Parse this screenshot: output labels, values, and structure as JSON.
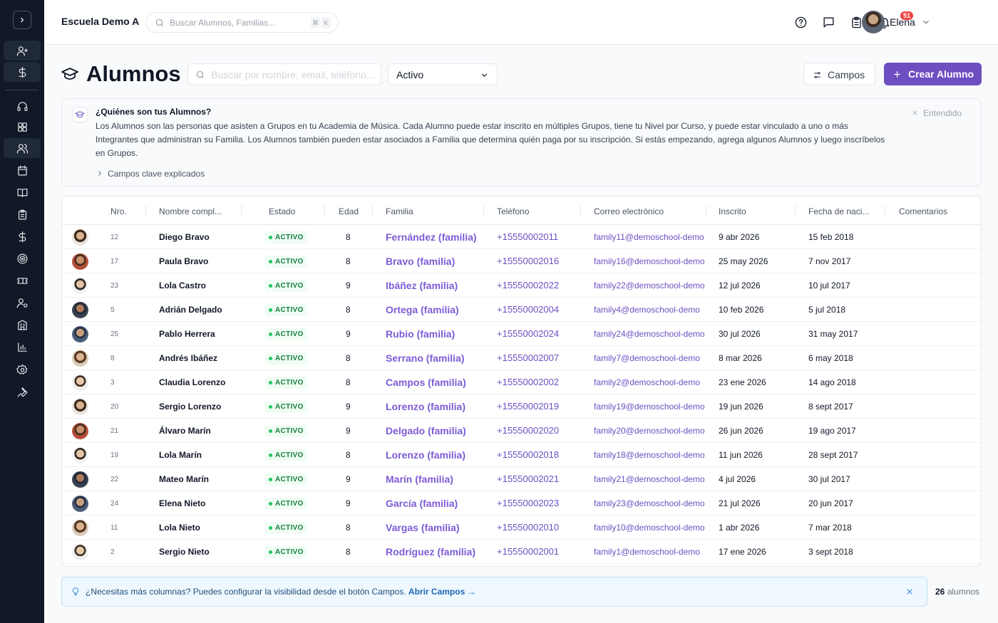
{
  "app": {
    "school_name": "Escuela Demo A",
    "user_name": "Elena",
    "notification_count": "51"
  },
  "global_search": {
    "placeholder": "Buscar Alumnos, Familias...",
    "kbd1": "⌘",
    "kbd2": "K"
  },
  "sidebar": {
    "icons": [
      "chevron-right-icon",
      "user-plus-icon",
      "dollar-icon",
      "headset-icon",
      "grid-icon",
      "users-icon",
      "calendar-icon",
      "book-icon",
      "clipboard-icon",
      "dollar-icon",
      "target-icon",
      "ticket-icon",
      "user-cog-icon",
      "building-icon",
      "bar-chart-icon",
      "settings-icon",
      "wrench-icon"
    ]
  },
  "page": {
    "title": "Alumnos",
    "search_placeholder": "Buscar por nombre, email, teléfono...",
    "status_filter": "Activo",
    "campos_button": "Campos",
    "create_button": "Crear Alumno"
  },
  "info": {
    "title": "¿Quiénes son tus Alumnos?",
    "body": "Los Alumnos son las personas que asisten a Grupos en tu Academia de Música. Cada Alumno puede estar inscrito en múltiples Grupos, tiene tu Nivel por Curso, y puede estar vinculado a uno o más Integrantes que administran su Familia. Los Alumnos también pueden estar asociados a Familia que determina quién paga por su inscripción. Si estás empezando, agrega algunos Alumnos y luego inscríbelos en Grupos.",
    "more_link": "Campos clave explicados",
    "dismiss": "Entendido"
  },
  "table": {
    "columns": [
      "Nro.",
      "Nombre compl...",
      "Estado",
      "Edad",
      "Familia",
      "Teléfono",
      "Correo electrónico",
      "Inscrito",
      "Fecha de naci...",
      "Comentarios"
    ],
    "rows": [
      {
        "nro": "12",
        "name": "Diego Bravo",
        "status": "ACTIVO",
        "age": "8",
        "family": "Fernández (familia)",
        "phone": "+15550002011",
        "email": "family11@demoschool-demo",
        "enrolled": "9 abr 2026",
        "birth": "15 feb 2018"
      },
      {
        "nro": "17",
        "name": "Paula Bravo",
        "status": "ACTIVO",
        "age": "8",
        "family": "Bravo (familia)",
        "phone": "+15550002016",
        "email": "family16@demoschool-demo",
        "enrolled": "25 may 2026",
        "birth": "7 nov 2017"
      },
      {
        "nro": "23",
        "name": "Lola Castro",
        "status": "ACTIVO",
        "age": "9",
        "family": "Ibáñez (familia)",
        "phone": "+15550002022",
        "email": "family22@demoschool-demo",
        "enrolled": "12 jul 2026",
        "birth": "10 jul 2017"
      },
      {
        "nro": "5",
        "name": "Adrián Delgado",
        "status": "ACTIVO",
        "age": "8",
        "family": "Ortega (familia)",
        "phone": "+15550002004",
        "email": "family4@demoschool-demo",
        "enrolled": "10 feb 2026",
        "birth": "5 jul 2018"
      },
      {
        "nro": "25",
        "name": "Pablo Herrera",
        "status": "ACTIVO",
        "age": "9",
        "family": "Rubio (familia)",
        "phone": "+15550002024",
        "email": "family24@demoschool-demo",
        "enrolled": "30 jul 2026",
        "birth": "31 may 2017"
      },
      {
        "nro": "8",
        "name": "Andrés Ibáñez",
        "status": "ACTIVO",
        "age": "8",
        "family": "Serrano (familia)",
        "phone": "+15550002007",
        "email": "family7@demoschool-demo",
        "enrolled": "8 mar 2026",
        "birth": "6 may 2018"
      },
      {
        "nro": "3",
        "name": "Claudia Lorenzo",
        "status": "ACTIVO",
        "age": "8",
        "family": "Campos (familia)",
        "phone": "+15550002002",
        "email": "family2@demoschool-demo",
        "enrolled": "23 ene 2026",
        "birth": "14 ago 2018"
      },
      {
        "nro": "20",
        "name": "Sergio Lorenzo",
        "status": "ACTIVO",
        "age": "9",
        "family": "Lorenzo (familia)",
        "phone": "+15550002019",
        "email": "family19@demoschool-demo",
        "enrolled": "19 jun 2026",
        "birth": "8 sept 2017"
      },
      {
        "nro": "21",
        "name": "Álvaro Marín",
        "status": "ACTIVO",
        "age": "9",
        "family": "Delgado (familia)",
        "phone": "+15550002020",
        "email": "family20@demoschool-demo",
        "enrolled": "26 jun 2026",
        "birth": "19 ago 2017"
      },
      {
        "nro": "19",
        "name": "Lola Marín",
        "status": "ACTIVO",
        "age": "8",
        "family": "Lorenzo (familia)",
        "phone": "+15550002018",
        "email": "family18@demoschool-demo",
        "enrolled": "11 jun 2026",
        "birth": "28 sept 2017"
      },
      {
        "nro": "22",
        "name": "Mateo Marín",
        "status": "ACTIVO",
        "age": "9",
        "family": "Marín (familia)",
        "phone": "+15550002021",
        "email": "family21@demoschool-demo",
        "enrolled": "4 jul 2026",
        "birth": "30 jul 2017"
      },
      {
        "nro": "24",
        "name": "Elena Nieto",
        "status": "ACTIVO",
        "age": "9",
        "family": "García (familia)",
        "phone": "+15550002023",
        "email": "family23@demoschool-demo",
        "enrolled": "21 jul 2026",
        "birth": "20 jun 2017"
      },
      {
        "nro": "11",
        "name": "Lola Nieto",
        "status": "ACTIVO",
        "age": "8",
        "family": "Vargas (familia)",
        "phone": "+15550002010",
        "email": "family10@demoschool-demo",
        "enrolled": "1 abr 2026",
        "birth": "7 mar 2018"
      },
      {
        "nro": "2",
        "name": "Sergio Nieto",
        "status": "ACTIVO",
        "age": "8",
        "family": "Rodríguez (familia)",
        "phone": "+15550002001",
        "email": "family1@demoschool-demo",
        "enrolled": "17 ene 2026",
        "birth": "3 sept 2018"
      }
    ]
  },
  "hint": {
    "text": "¿Necesitas más columnas? Puedes configurar la visibilidad desde el botón Campos.",
    "link": "Abrir Campos →"
  },
  "footer": {
    "count_number": "26",
    "count_label": "alumnos"
  },
  "colors": {
    "sidebar_bg": "#111827",
    "accent": "#6d4fc2",
    "status_green": "#15803d",
    "hint_bg": "#eff8ff"
  }
}
